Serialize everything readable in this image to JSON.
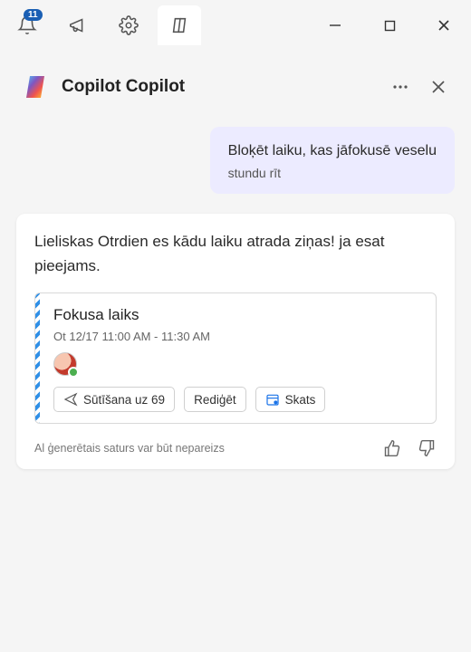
{
  "titlebar": {
    "notification_badge": "11"
  },
  "header": {
    "title": "Copilot Copilot"
  },
  "user_message": {
    "line1": "Bloķēt laiku, kas jāfokusē veselu",
    "line2": "stundu rīt"
  },
  "assistant": {
    "text_left": "Lieliskas ziņas!",
    "text_right": "Otrdien es kādu laiku atrada ja esat pieejams.",
    "combined": "Lieliskas        Otrdien es kādu laiku atrada ziņas! ja esat pieejams."
  },
  "event": {
    "title": "Fokusa laiks",
    "time": "Ot 12/17 11:00 AM - 11:30 AM",
    "actions": {
      "send": "Sūtīšana uz 69",
      "edit": "Rediģēt",
      "view": "Skats"
    }
  },
  "footer": {
    "disclaimer": "Al ģenerētais saturs var būt nepareizs"
  }
}
